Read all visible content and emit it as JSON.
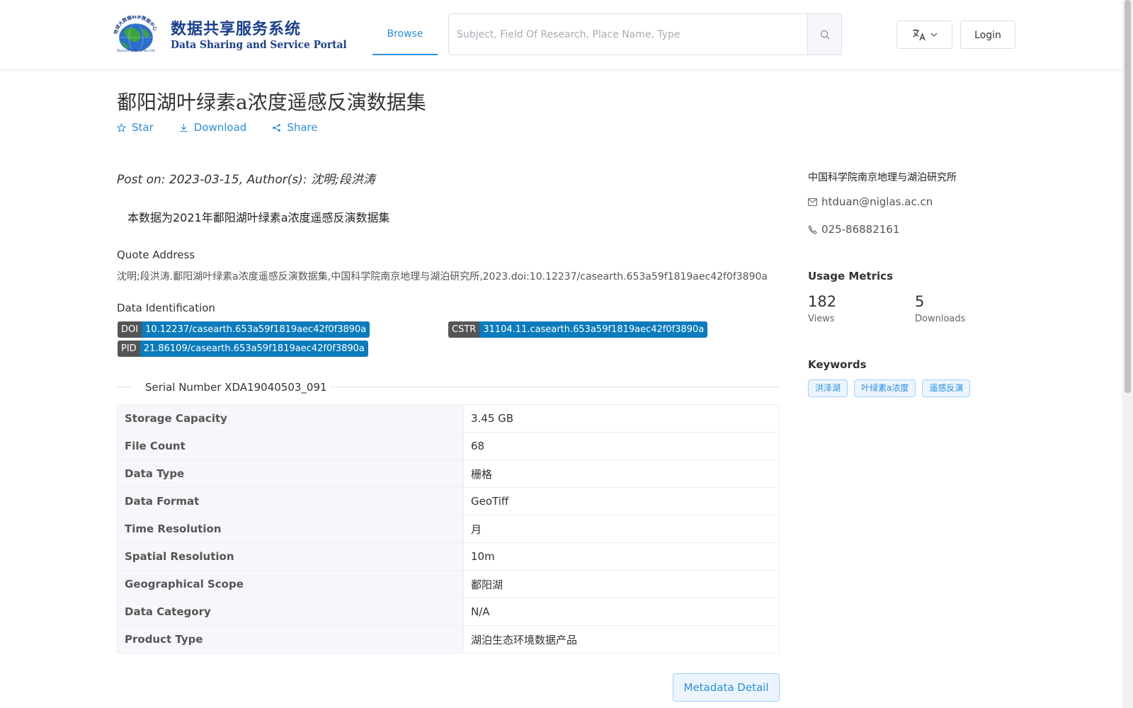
{
  "header": {
    "logo_cn": "数据共享服务系统",
    "logo_en": "Data Sharing and Service Portal",
    "logo_ring": "地球大数据科学数据中心",
    "logo_globe_caption": "Big Earth Data Center,CAS",
    "nav_browse": "Browse",
    "search_placeholder": "Subject, Field Of Research, Place Name, Type",
    "login": "Login",
    "icons": {
      "search": "search-icon",
      "language": "translate-icon",
      "chevron": "chevron-down-icon"
    }
  },
  "dataset": {
    "title": "鄱阳湖叶绿素a浓度遥感反演数据集",
    "actions": {
      "star": "Star",
      "download": "Download",
      "share": "Share"
    },
    "post_info": "Post on: 2023-03-15, Author(s): 沈明;段洪涛",
    "description": "本数据为2021年鄱阳湖叶绿素a浓度遥感反演数据集",
    "quote_label": "Quote Address",
    "quote_text": "沈明;段洪涛.鄱阳湖叶绿素a浓度遥感反演数据集,中国科学院南京地理与湖泊研究所,2023.doi:10.12237/casearth.653a59f1819aec42f0f3890a",
    "identification_label": "Data Identification",
    "identifiers": [
      {
        "key": "DOI",
        "value": "10.12237/casearth.653a59f1819aec42f0f3890a"
      },
      {
        "key": "CSTR",
        "value": "31104.11.casearth.653a59f1819aec42f0f3890a"
      },
      {
        "key": "PID",
        "value": "21.86109/casearth.653a59f1819aec42f0f3890a"
      }
    ],
    "serial": "Serial Number XDA19040503_091",
    "properties": [
      {
        "key": "Storage Capacity",
        "value": "3.45 GB"
      },
      {
        "key": "File Count",
        "value": "68"
      },
      {
        "key": "Data Type",
        "value": "栅格"
      },
      {
        "key": "Data Format",
        "value": "GeoTiff"
      },
      {
        "key": "Time Resolution",
        "value": "月"
      },
      {
        "key": "Spatial Resolution",
        "value": "10m"
      },
      {
        "key": "Geographical Scope",
        "value": "鄱阳湖"
      },
      {
        "key": "Data Category",
        "value": "N/A"
      },
      {
        "key": "Product Type",
        "value": "湖泊生态环境数据产品"
      }
    ],
    "metadata_button": "Metadata Detail"
  },
  "sidebar": {
    "organization": "中国科学院南京地理与湖泊研究所",
    "email": "htduan@niglas.ac.cn",
    "phone": "025-86882161",
    "usage_title": "Usage Metrics",
    "views": "182",
    "views_label": "Views",
    "downloads": "5",
    "downloads_label": "Downloads",
    "keywords_title": "Keywords",
    "keywords": [
      "洪泽湖",
      "叶绿素a浓度",
      "遥感反演"
    ]
  },
  "colors": {
    "accent": "#2b8fe0",
    "badge_key": "#555555",
    "badge_value": "#0a7bbd",
    "logo": "#1b3f8f"
  }
}
